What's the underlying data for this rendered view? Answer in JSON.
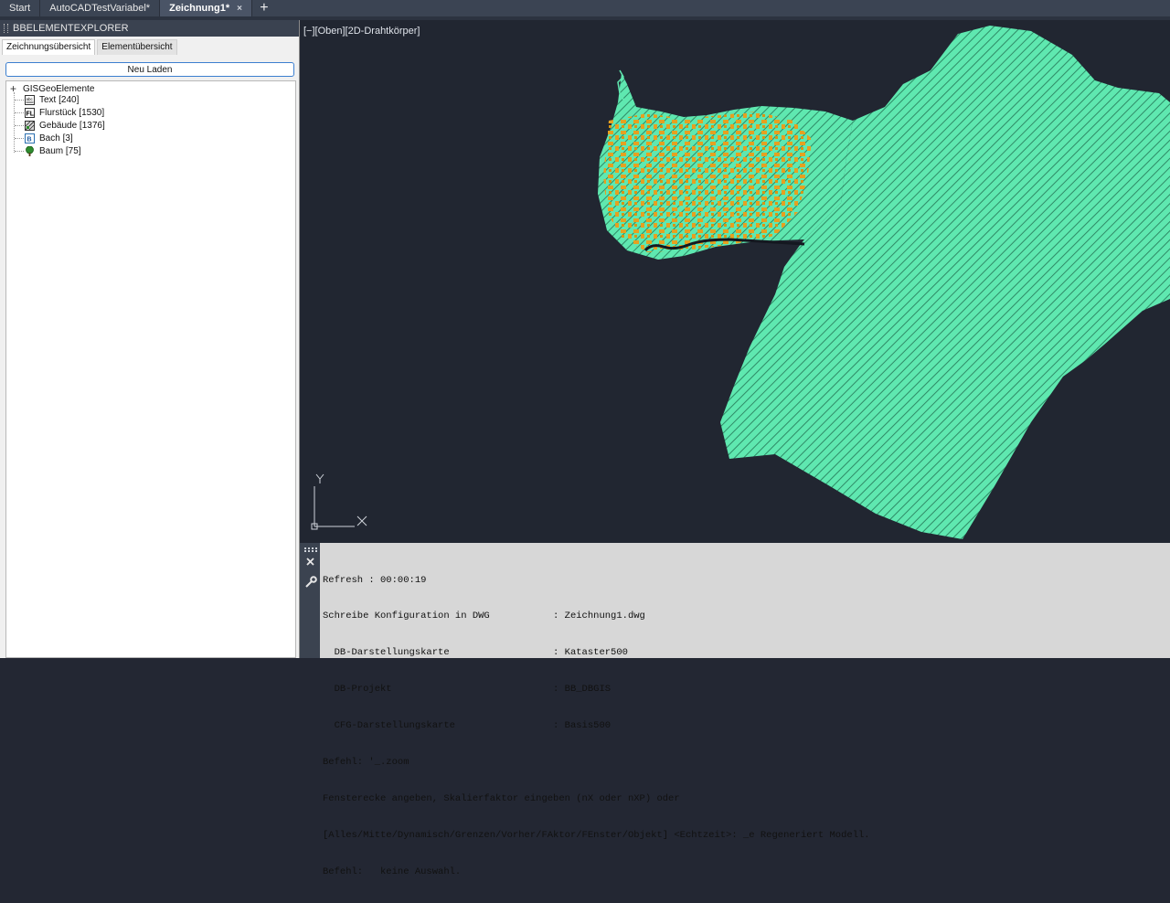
{
  "tabs": [
    {
      "label": "Start",
      "active": false,
      "closable": false
    },
    {
      "label": "AutoCADTestVariabel*",
      "active": false,
      "closable": false
    },
    {
      "label": "Zeichnung1*",
      "active": true,
      "closable": true
    }
  ],
  "tab_close_icon": "×",
  "tab_add_label": "+",
  "panel": {
    "title": "BBELEMENTEXPLORER",
    "tabs": [
      "Zeichnungsübersicht",
      "Elementübersicht"
    ],
    "reload_label": "Neu Laden",
    "tree_root": "GISGeoElemente",
    "tree_items": [
      {
        "label": "Text [240]",
        "icon": "text-layer-icon"
      },
      {
        "label": "Flurstück [1530]",
        "icon": "parcel-layer-icon"
      },
      {
        "label": "Gebäude [1376]",
        "icon": "building-layer-icon"
      },
      {
        "label": "Bach [3]",
        "icon": "stream-layer-icon"
      },
      {
        "label": "Baum [75]",
        "icon": "tree-layer-icon"
      }
    ]
  },
  "viewport": {
    "label": "[−][Oben][2D-Drahtkörper]",
    "ucs_y": "Y",
    "ucs_x": "X",
    "colors": {
      "background": "#212631",
      "parcels": "#5fe8b0",
      "buildings": "#e6a020",
      "stream": "#1a1f24"
    }
  },
  "command_lines": [
    "Refresh : 00:00:19",
    "Schreibe Konfiguration in DWG           : Zeichnung1.dwg",
    "  DB-Darstellungskarte                  : Kataster500",
    "  DB-Projekt                            : BB_DBGIS",
    "  CFG-Darstellungskarte                 : Basis500",
    "Befehl: '_.zoom",
    "Fensterecke angeben, Skalierfaktor eingeben (nX oder nXP) oder",
    "[Alles/Mitte/Dynamisch/Grenzen/Vorher/FAktor/FEnster/Objekt] <Echtzeit>: _e Regeneriert Modell.",
    "Befehl:   keine Auswahl."
  ]
}
